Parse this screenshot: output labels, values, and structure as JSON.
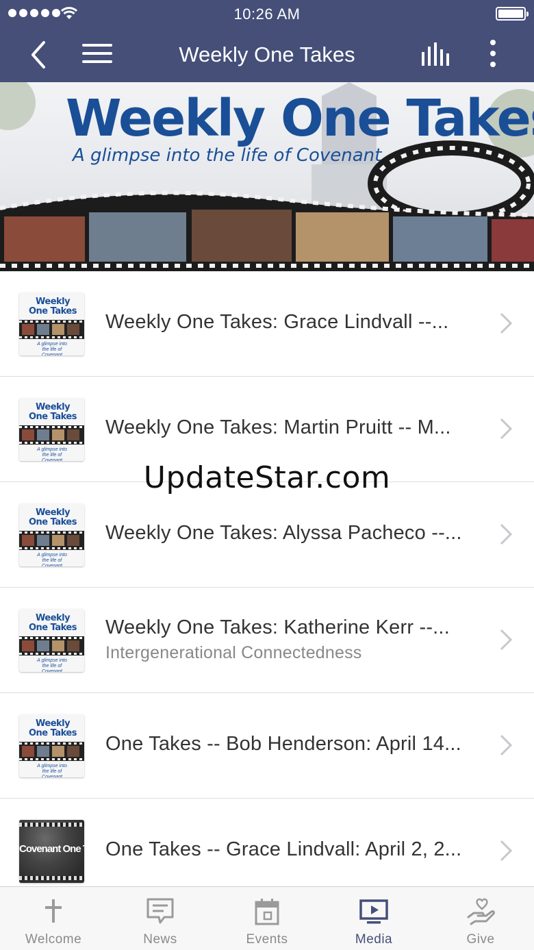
{
  "status_bar": {
    "time": "10:26 AM"
  },
  "nav": {
    "title": "Weekly One Takes"
  },
  "banner": {
    "title": "Weekly One Takes",
    "subtitle": "A glimpse into the life of Covenant"
  },
  "thumbnail": {
    "line1": "Weekly",
    "line2": "One Takes",
    "caption": "A glimpse into the life of Covenant",
    "dark_text": "Covenant One Takes"
  },
  "items": [
    {
      "title": "Weekly One Takes: Grace Lindvall --...",
      "subtitle": ""
    },
    {
      "title": "Weekly One Takes: Martin Pruitt -- M...",
      "subtitle": ""
    },
    {
      "title": "Weekly One Takes: Alyssa Pacheco --...",
      "subtitle": ""
    },
    {
      "title": "Weekly One Takes: Katherine Kerr --...",
      "subtitle": "Intergenerational Connectedness"
    },
    {
      "title": "One Takes -- Bob Henderson: April 14...",
      "subtitle": ""
    },
    {
      "title": "One Takes -- Grace Lindvall: April 2, 2...",
      "subtitle": ""
    }
  ],
  "watermark": "UpdateStar.com",
  "tabs": [
    {
      "label": "Welcome",
      "icon": "cross-icon"
    },
    {
      "label": "News",
      "icon": "speech-bubble-icon"
    },
    {
      "label": "Events",
      "icon": "calendar-icon"
    },
    {
      "label": "Media",
      "icon": "tv-play-icon"
    },
    {
      "label": "Give",
      "icon": "hand-heart-icon"
    }
  ],
  "colors": {
    "header_bg": "#454f78",
    "brand_blue": "#1a4f97",
    "active_tab": "#454f78",
    "inactive_tab": "#8a8a8a"
  }
}
